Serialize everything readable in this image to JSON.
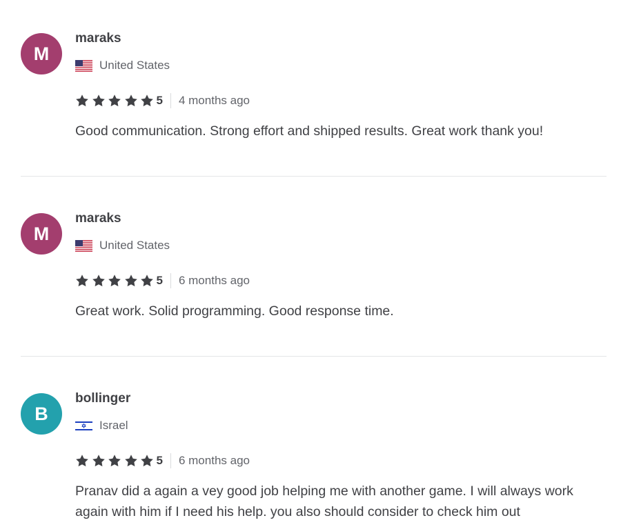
{
  "reviews": [
    {
      "avatar_letter": "M",
      "avatar_color": "#a33e6e",
      "username": "maraks",
      "country": "United States",
      "country_flag": "us-flag",
      "rating": "5",
      "stars": 5,
      "time_ago": "4 months ago",
      "text": "Good communication. Strong effort and shipped results. Great work thank you!"
    },
    {
      "avatar_letter": "M",
      "avatar_color": "#a33e6e",
      "username": "maraks",
      "country": "United States",
      "country_flag": "us-flag",
      "rating": "5",
      "stars": 5,
      "time_ago": "6 months ago",
      "text": "Great work. Solid programming. Good response time."
    },
    {
      "avatar_letter": "B",
      "avatar_color": "#23a1ad",
      "username": "bollinger",
      "country": "Israel",
      "country_flag": "israel-flag",
      "rating": "5",
      "stars": 5,
      "time_ago": "6 months ago",
      "text": "Pranav did a again a vey good job helping me with another game. I will always work again with him if I need his help. you also should consider to check him out"
    }
  ],
  "colors": {
    "star": "#404145",
    "divider": "#e4e5e7",
    "text": "#404145",
    "muted": "#62646a"
  }
}
